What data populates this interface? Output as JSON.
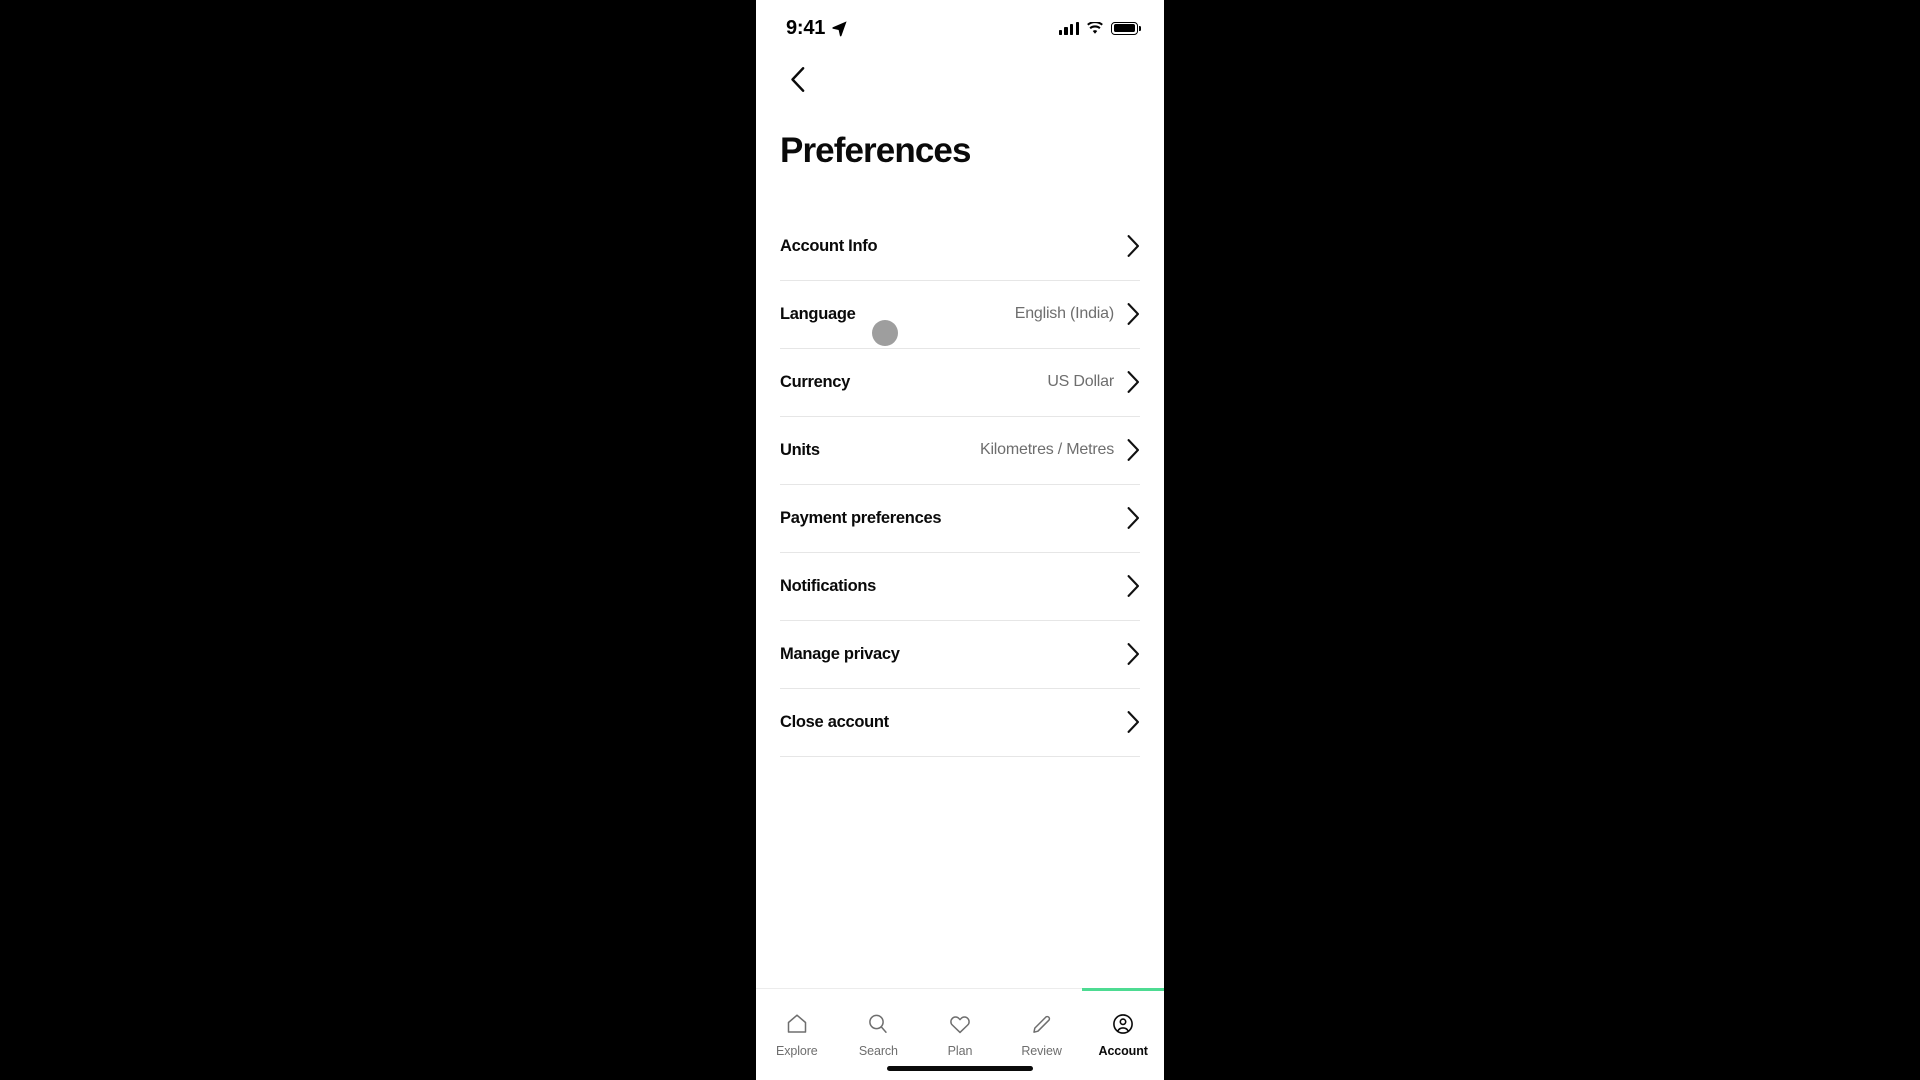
{
  "status_bar": {
    "time": "9:41",
    "location_icon": "location-arrow-icon",
    "signal_icon": "cellular-signal-icon",
    "wifi_icon": "wifi-icon",
    "battery_icon": "battery-full-icon"
  },
  "nav": {
    "back_icon": "chevron-left-icon"
  },
  "header": {
    "title": "Preferences"
  },
  "list": {
    "rows": [
      {
        "label": "Account Info",
        "value": "",
        "chevron": "chevron-right-icon"
      },
      {
        "label": "Language",
        "value": "English (India)",
        "chevron": "chevron-right-icon"
      },
      {
        "label": "Currency",
        "value": "US Dollar",
        "chevron": "chevron-right-icon"
      },
      {
        "label": "Units",
        "value": "Kilometres / Metres",
        "chevron": "chevron-right-icon"
      },
      {
        "label": "Payment preferences",
        "value": "",
        "chevron": "chevron-right-icon"
      },
      {
        "label": "Notifications",
        "value": "",
        "chevron": "chevron-right-icon"
      },
      {
        "label": "Manage privacy",
        "value": "",
        "chevron": "chevron-right-icon"
      },
      {
        "label": "Close account",
        "value": "",
        "chevron": "chevron-right-icon"
      }
    ]
  },
  "cursor": {
    "name": "touch-indicator",
    "color": "#9e9e9e"
  },
  "tabbar": {
    "active_color": "#4ddb92",
    "tabs": [
      {
        "label": "Explore",
        "icon": "home-icon",
        "active": false
      },
      {
        "label": "Search",
        "icon": "search-icon",
        "active": false
      },
      {
        "label": "Plan",
        "icon": "heart-icon",
        "active": false
      },
      {
        "label": "Review",
        "icon": "pencil-icon",
        "active": false
      },
      {
        "label": "Account",
        "icon": "person-circle-icon",
        "active": true
      }
    ]
  }
}
